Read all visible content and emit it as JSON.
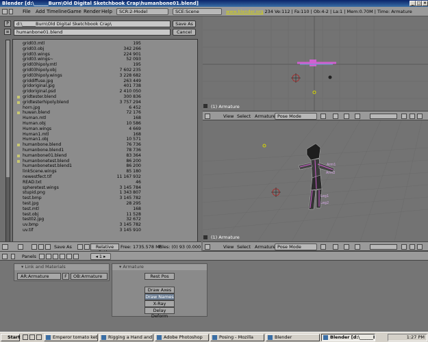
{
  "window": {
    "title": "Blender [d:\\______Burn\\Old Digital Sketchbook Crap\\humanbone01.blend]"
  },
  "infobar": {
    "menus": [
      "File",
      "Add",
      "Timeline",
      "Game",
      "Render",
      "Help"
    ],
    "screen": "SCR:2-Model",
    "scene": "SCE:Scene",
    "site": "www.blender.org",
    "version": "234",
    "stats": "Ve:112 | Fa:110 | Ob:4-2 | La:1 | Mem:0.70M | Time:",
    "time_label": "Armature"
  },
  "filebrowser": {
    "path": "d:\\______Burn\\Old Digital Sketchbook Crap\\",
    "filename": "humanbone01.blend",
    "save_label": "Save As",
    "cancel_label": "Cancel",
    "files": [
      {
        "name": "grid03.mtl",
        "size": "195",
        "blend": false
      },
      {
        "name": "grid03.obj",
        "size": "342 266",
        "blend": false
      },
      {
        "name": "grid03.wings",
        "size": "224 901",
        "blend": false
      },
      {
        "name": "grid03.wings~",
        "size": "52 093",
        "blend": false
      },
      {
        "name": "grid03hipoly.mtl",
        "size": "195",
        "blend": false
      },
      {
        "name": "grid03hipoly.obj",
        "size": "7 602 235",
        "blend": false
      },
      {
        "name": "grid03hipoly.wings",
        "size": "3 228 682",
        "blend": false
      },
      {
        "name": "griddiffuse.jpg",
        "size": "263 449",
        "blend": false
      },
      {
        "name": "gridoriginal.jpg",
        "size": "401 738",
        "blend": false
      },
      {
        "name": "gridoriginal.psd",
        "size": "2 410 050",
        "blend": false
      },
      {
        "name": "gridtester.blend",
        "size": "300 836",
        "blend": true
      },
      {
        "name": "gridtesterhipoly.blend",
        "size": "3 757 294",
        "blend": true
      },
      {
        "name": "horn.jpg",
        "size": "6 452",
        "blend": false
      },
      {
        "name": "huwan.blend",
        "size": "72 176",
        "blend": true
      },
      {
        "name": "Human.mtl",
        "size": "168",
        "blend": false
      },
      {
        "name": "Human.obj",
        "size": "10 586",
        "blend": false
      },
      {
        "name": "Human.wings",
        "size": "4 669",
        "blend": false
      },
      {
        "name": "Human1.mtl",
        "size": "168",
        "blend": false
      },
      {
        "name": "Human1.obj",
        "size": "10 571",
        "blend": false
      },
      {
        "name": "humanbone.blend",
        "size": "76 736",
        "blend": true
      },
      {
        "name": "humanbone.blend1",
        "size": "78 736",
        "blend": false
      },
      {
        "name": "humanbone01.blend",
        "size": "83 364",
        "blend": true
      },
      {
        "name": "humanbonetest.blend",
        "size": "86 200",
        "blend": true
      },
      {
        "name": "humanbonetest.blend1",
        "size": "86 200",
        "blend": false
      },
      {
        "name": "linkScene.wings",
        "size": "85 180",
        "blend": false
      },
      {
        "name": "newestfect.tif",
        "size": "11 167 932",
        "blend": false
      },
      {
        "name": "READ.txt",
        "size": "46",
        "blend": false
      },
      {
        "name": "spheretest.wings",
        "size": "3 145 784",
        "blend": false
      },
      {
        "name": "stupid.png",
        "size": "1 343 807",
        "blend": false
      },
      {
        "name": "test.bmp",
        "size": "3 145 782",
        "blend": false
      },
      {
        "name": "test.jpg",
        "size": "28 295",
        "blend": false
      },
      {
        "name": "test.mtl",
        "size": "168",
        "blend": false
      },
      {
        "name": "test.obj",
        "size": "11 528",
        "blend": false
      },
      {
        "name": "test02.jpg",
        "size": "32 672",
        "blend": false
      },
      {
        "name": "uv.bmp",
        "size": "3 145 782",
        "blend": false
      },
      {
        "name": "uv.tif",
        "size": "3 145 910",
        "blend": false
      }
    ]
  },
  "fbfooter": {
    "save_as": "Save As",
    "relative_paths": "Relative Paths",
    "free": "Free: 1735.578 Mb",
    "files": "Files: (0) 93",
    "extra": "(0.000"
  },
  "viewport_top": {
    "label": "(1) Armature",
    "menus": [
      "View",
      "Select",
      "Armature"
    ],
    "mode": "Pose Mode"
  },
  "viewport_bottom": {
    "label": "(1) Armature",
    "menus": [
      "View",
      "Select",
      "Armature"
    ],
    "mode": "Pose Mode",
    "bones": [
      "Arm1",
      "Arm2",
      "Leg1",
      "Leg2"
    ]
  },
  "buttons": {
    "header_label": "Panels",
    "frame": "1",
    "link_panel": {
      "title": "Link and Materials",
      "ar_field": "AR:Armature",
      "f_label": "F",
      "ob_field": "OB:Armature"
    },
    "arm_panel": {
      "title": "Armature",
      "rest_pos": "Rest Pos",
      "options": [
        "Draw Axes",
        "Draw Names",
        "X-Ray",
        "Delay Deform"
      ],
      "active_option": "Draw Names"
    }
  },
  "taskbar": {
    "start": "Start",
    "tasks": [
      "Emperor tomato ketchup",
      "Rigging a Hand and a Foo...",
      "Adobe Photoshop",
      "Posing - Mozilla",
      "Blender",
      "Blender [d:\\______Burn..."
    ],
    "active_task": "Blender [d:\\______Burn...",
    "clock": "1:27 PM"
  }
}
